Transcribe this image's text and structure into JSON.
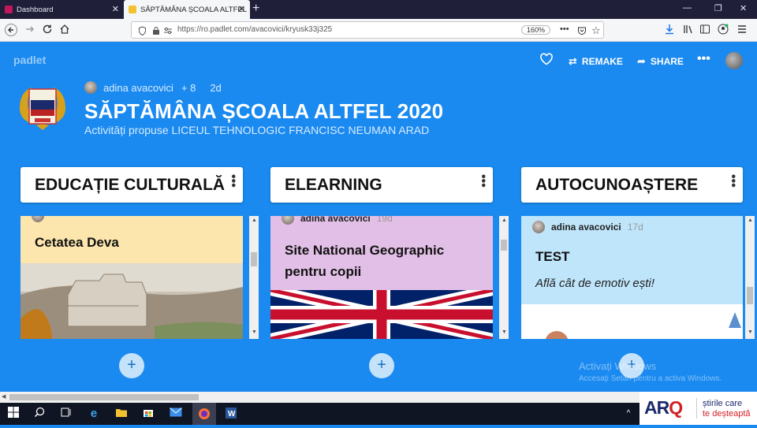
{
  "browser": {
    "tabs": [
      {
        "label": "Dashboard",
        "active": false
      },
      {
        "label": "SĂPTĂMÂNA ȘCOALA ALTFEL",
        "active": true
      }
    ],
    "new_tab": "+",
    "close_glyph": "✕",
    "url": "https://ro.padlet.com/avacovici/kryusk33j325",
    "zoom": "160%",
    "window_controls": {
      "minimize": "—",
      "maximize": "❐",
      "close": "✕"
    }
  },
  "padlet": {
    "logo": "padlet",
    "actions": {
      "remake": "REMAKE",
      "share": "SHARE",
      "more": "•••"
    },
    "author": "adina avacovici",
    "contributors": "+ 8",
    "age": "2d",
    "title": "SĂPTĂMÂNA ȘCOALA ALTFEL 2020",
    "subtitle": "Activități propuse LICEUL TEHNOLOGIC FRANCISC NEUMAN ARAD",
    "emblem_text": "LICEUL TEHNOLOGIC FRANCISC NEUMAN ARAD"
  },
  "columns": [
    {
      "header": "EDUCAȚIE CULTURALĂ",
      "card": {
        "author": "",
        "time": "",
        "title": "Cetatea Deva",
        "body": "",
        "color": "#fde6ae"
      },
      "add": "+"
    },
    {
      "header": "ELEARNING",
      "card": {
        "author": "adina avacovici",
        "time": "19d",
        "title": "Site National Geographic pentru copii",
        "body": "",
        "color": "#e2bfe6"
      },
      "add": "+"
    },
    {
      "header": "AUTOCUNOAȘTERE",
      "card": {
        "author": "adina avacovici",
        "time": "17d",
        "title": "TEST",
        "body": "Află cât de emotiv ești!",
        "color": "#bfe5fb"
      },
      "add": "+"
    }
  ],
  "watermark": {
    "line1": "Activați Windows",
    "line2": "Accesați Setări pentru a activa Windows."
  },
  "arq": {
    "logo_a": "AR",
    "logo_q": "Q",
    "tagline1": "știrile care",
    "tagline2": "te deșteaptă"
  },
  "icons": [
    "back-icon",
    "forward-icon",
    "reload-icon",
    "home-icon",
    "shield-icon",
    "lock-icon",
    "more-icon",
    "pocket-icon",
    "star-icon",
    "download-icon",
    "library-icon",
    "sidebar-icon",
    "account-icon",
    "menu-icon",
    "heart-icon",
    "remake-icon",
    "share-icon",
    "windows-start-icon",
    "search-icon",
    "task-view-icon",
    "edge-icon",
    "explorer-icon",
    "store-icon",
    "mail-icon",
    "firefox-icon",
    "word-icon"
  ]
}
